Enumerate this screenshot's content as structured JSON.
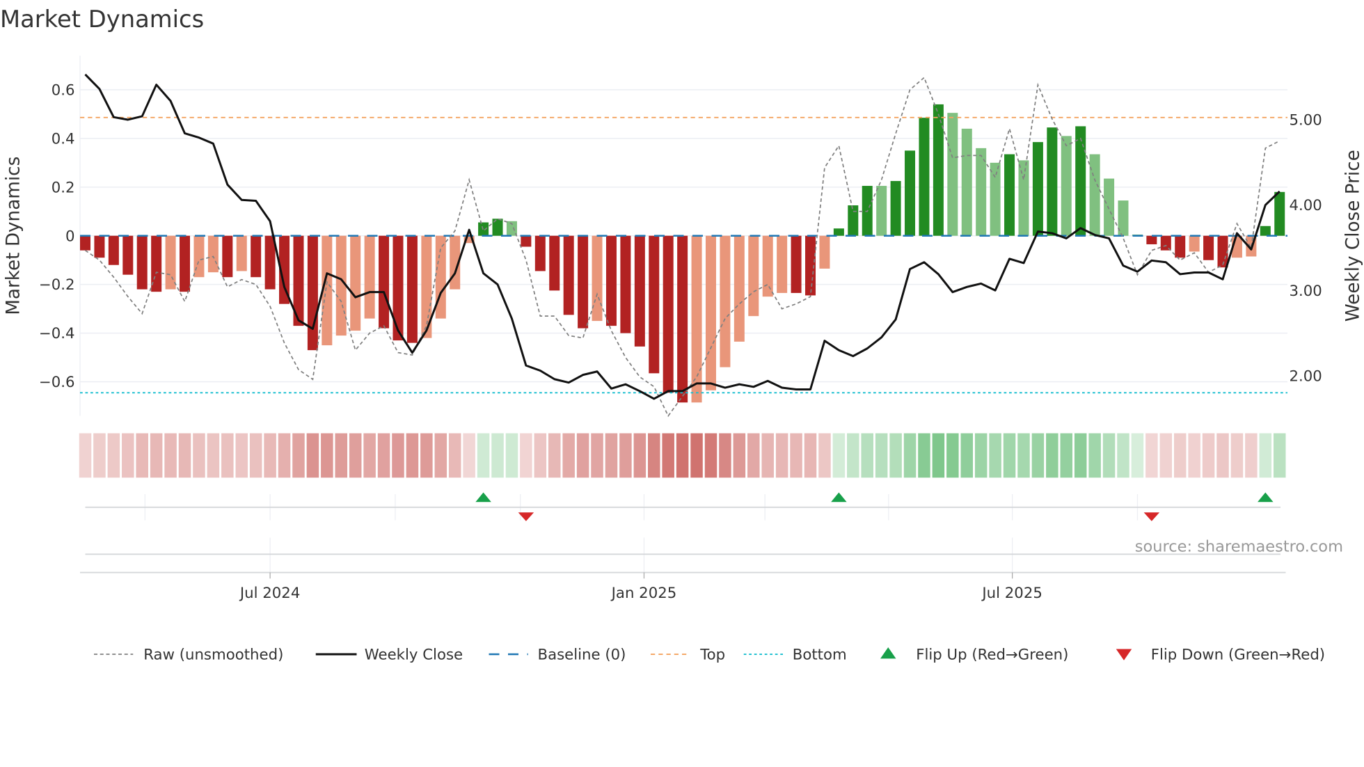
{
  "chart_data": {
    "type": "bar",
    "title": "Market Dynamics",
    "ylabel": "Market Dynamics",
    "y2label": "Weekly Close Price",
    "ylim": [
      -0.74,
      0.74
    ],
    "y2lim": [
      1.52,
      5.74
    ],
    "yticks": [
      -0.6,
      -0.4,
      -0.2,
      0,
      0.2,
      0.4,
      0.6
    ],
    "ytick_labels": [
      "−0.6",
      "−0.4",
      "−0.2",
      "0",
      "0.2",
      "0.4",
      "0.6"
    ],
    "y2ticks": [
      2,
      3,
      4,
      5
    ],
    "y2tick_labels": [
      "2.00",
      "3.00",
      "4.00",
      "5.00"
    ],
    "xticks": [
      {
        "label": "Jul 2024",
        "index": 13.0
      },
      {
        "label": "Jan 2025",
        "index": 39.3
      },
      {
        "label": "Jul 2025",
        "index": 65.2
      }
    ],
    "minor_grid_index": [
      4.2,
      13.0,
      21.8,
      30.6,
      39.3,
      47.8,
      56.5,
      65.2,
      74.0
    ],
    "frequency": "weekly",
    "top": 0.486,
    "bottom": -0.645,
    "baseline": 0,
    "smoothed": [
      -0.06,
      -0.09,
      -0.12,
      -0.16,
      -0.22,
      -0.23,
      -0.22,
      -0.23,
      -0.17,
      -0.15,
      -0.17,
      -0.145,
      -0.17,
      -0.22,
      -0.28,
      -0.37,
      -0.47,
      -0.45,
      -0.41,
      -0.39,
      -0.34,
      -0.38,
      -0.43,
      -0.44,
      -0.42,
      -0.34,
      -0.22,
      -0.03,
      0.055,
      0.07,
      0.06,
      -0.045,
      -0.145,
      -0.225,
      -0.325,
      -0.38,
      -0.35,
      -0.37,
      -0.4,
      -0.455,
      -0.565,
      -0.645,
      -0.685,
      -0.685,
      -0.635,
      -0.54,
      -0.435,
      -0.33,
      -0.25,
      -0.235,
      -0.235,
      -0.245,
      -0.135,
      0.03,
      0.125,
      0.205,
      0.205,
      0.225,
      0.35,
      0.485,
      0.54,
      0.505,
      0.44,
      0.36,
      0.3,
      0.335,
      0.31,
      0.385,
      0.445,
      0.41,
      0.45,
      0.335,
      0.235,
      0.145,
      0.005,
      -0.035,
      -0.06,
      -0.09,
      -0.065,
      -0.1,
      -0.13,
      -0.09,
      -0.085,
      0.04,
      0.18
    ],
    "strengthening": [
      1,
      1,
      1,
      1,
      1,
      1,
      0,
      1,
      0,
      0,
      1,
      0,
      1,
      1,
      1,
      1,
      1,
      0,
      0,
      0,
      0,
      1,
      1,
      1,
      0,
      0,
      0,
      0,
      1,
      1,
      0,
      1,
      1,
      1,
      1,
      1,
      0,
      1,
      1,
      1,
      1,
      1,
      1,
      0,
      0,
      0,
      0,
      0,
      0,
      0,
      1,
      1,
      0,
      1,
      1,
      1,
      0,
      1,
      1,
      1,
      1,
      0,
      0,
      0,
      0,
      1,
      0,
      1,
      1,
      0,
      1,
      0,
      0,
      0,
      0,
      1,
      1,
      1,
      0,
      1,
      1,
      0,
      0,
      1,
      1
    ],
    "raw": [
      -0.06,
      -0.1,
      -0.17,
      -0.25,
      -0.32,
      -0.15,
      -0.16,
      -0.27,
      -0.1,
      -0.085,
      -0.21,
      -0.18,
      -0.2,
      -0.29,
      -0.44,
      -0.55,
      -0.59,
      -0.19,
      -0.27,
      -0.47,
      -0.4,
      -0.37,
      -0.48,
      -0.49,
      -0.37,
      -0.05,
      0.02,
      0.23,
      0.02,
      0.07,
      0.05,
      -0.1,
      -0.33,
      -0.33,
      -0.41,
      -0.42,
      -0.24,
      -0.39,
      -0.5,
      -0.58,
      -0.62,
      -0.74,
      -0.66,
      -0.58,
      -0.46,
      -0.34,
      -0.28,
      -0.23,
      -0.2,
      -0.3,
      -0.28,
      -0.25,
      0.28,
      0.37,
      0.1,
      0.1,
      0.23,
      0.42,
      0.6,
      0.65,
      0.5,
      0.32,
      0.33,
      0.33,
      0.24,
      0.44,
      0.23,
      0.62,
      0.48,
      0.37,
      0.4,
      0.23,
      0.11,
      -0.01,
      -0.16,
      -0.06,
      -0.04,
      -0.1,
      -0.07,
      -0.15,
      -0.12,
      0.05,
      -0.05,
      0.36,
      0.39
    ],
    "close": [
      5.52,
      5.35,
      5.02,
      4.99,
      5.03,
      5.4,
      5.21,
      4.83,
      4.78,
      4.71,
      4.23,
      4.05,
      4.04,
      3.8,
      3.03,
      2.64,
      2.54,
      3.19,
      3.12,
      2.91,
      2.97,
      2.97,
      2.52,
      2.26,
      2.52,
      2.96,
      3.19,
      3.7,
      3.19,
      3.06,
      2.66,
      2.11,
      2.05,
      1.95,
      1.91,
      2.0,
      2.04,
      1.84,
      1.89,
      1.81,
      1.72,
      1.81,
      1.81,
      1.9,
      1.9,
      1.85,
      1.89,
      1.86,
      1.93,
      1.85,
      1.83,
      1.83,
      2.4,
      2.29,
      2.22,
      2.31,
      2.44,
      2.65,
      3.24,
      3.32,
      3.18,
      2.97,
      3.03,
      3.07,
      2.99,
      3.36,
      3.31,
      3.68,
      3.66,
      3.6,
      3.72,
      3.64,
      3.6,
      3.28,
      3.21,
      3.34,
      3.32,
      3.18,
      3.2,
      3.2,
      3.12,
      3.66,
      3.47,
      3.99,
      4.15
    ],
    "flip_up_index": [
      28,
      53,
      83
    ],
    "flip_down_index": [
      31,
      75
    ],
    "legend": [
      "Raw (unsmoothed)",
      "Weekly Close",
      "Baseline (0)",
      "Top",
      "Bottom",
      "Flip Up (Red→Green)",
      "Flip Down (Green→Red)"
    ],
    "legend_position": "bottom",
    "source": "source: sharemaestro.com",
    "colors": {
      "red_strong": "#b22222",
      "red_weak": "#e9967a",
      "green_strong": "#228b22",
      "green_weak": "#80c080",
      "baseline": "#1f77b4",
      "top": "#f4a460",
      "bottom": "#17becf",
      "raw": "#808080",
      "close": "#111111",
      "flip_up": "#18a04a",
      "flip_down": "#d62728"
    }
  }
}
